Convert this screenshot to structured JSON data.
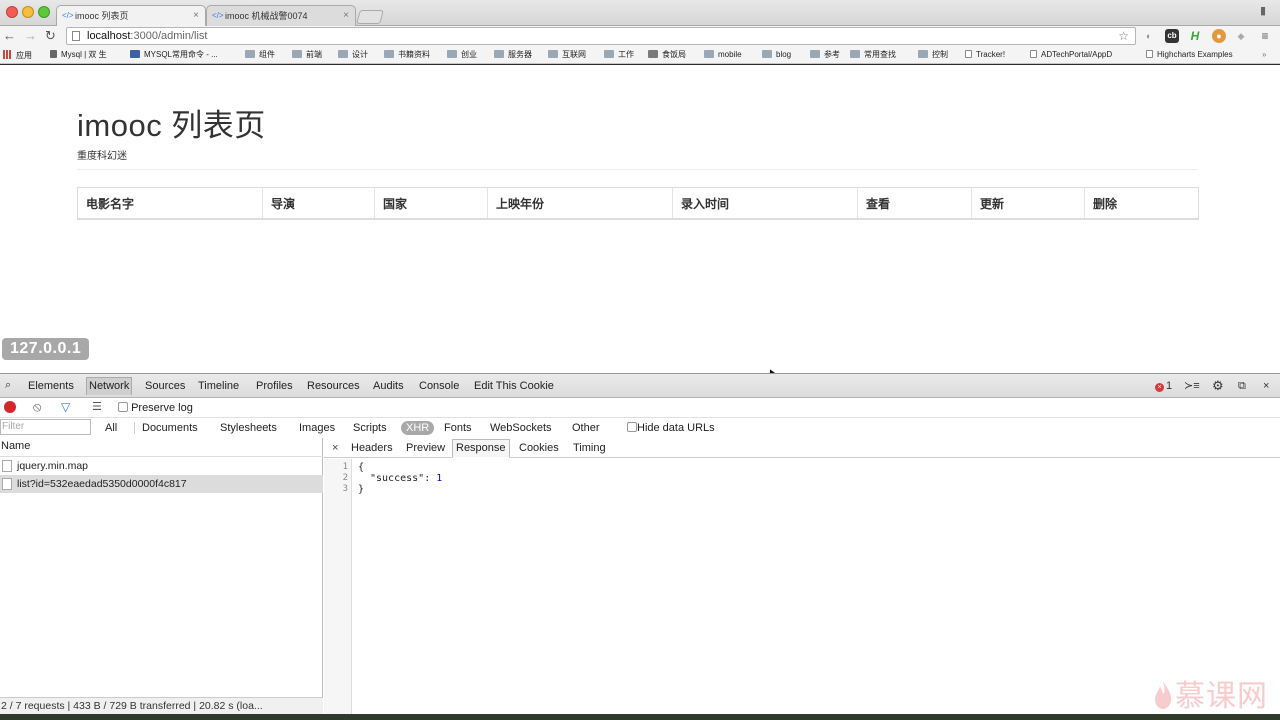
{
  "browser": {
    "tabs": [
      {
        "title": "imooc 列表页",
        "active": true
      },
      {
        "title": "imooc 机械战警0074",
        "active": false
      }
    ],
    "url_host": "localhost",
    "url_path": ":3000/admin/list",
    "bookmarks": [
      "应用",
      "Mysql | 双 生",
      "MYSQL常用命令 - ...",
      "组件",
      "前端",
      "设计",
      "书籍资料",
      "创业",
      "服务器",
      "互联网",
      "工作",
      "食饭局",
      "mobile",
      "blog",
      "参考",
      "常用查找",
      "控制",
      "Tracker!",
      "ADTechPortal/AppD",
      "Highcharts Examples"
    ],
    "extension_labels": [
      "cb",
      "H"
    ]
  },
  "page": {
    "title": "imooc 列表页",
    "subtitle": "重度科幻迷",
    "table_headers": [
      "电影名字",
      "导演",
      "国家",
      "上映年份",
      "录入时间",
      "查看",
      "更新",
      "删除"
    ],
    "host_badge": "127.0.0.1"
  },
  "devtools": {
    "tabs": [
      "Elements",
      "Network",
      "Sources",
      "Timeline",
      "Profiles",
      "Resources",
      "Audits",
      "Console",
      "Edit This Cookie"
    ],
    "selected_tab": "Network",
    "error_count": "1",
    "preserve_log": "Preserve log",
    "filter_placeholder": "Filter",
    "resource_types": [
      "All",
      "Documents",
      "Stylesheets",
      "Images",
      "Scripts",
      "XHR",
      "Fonts",
      "WebSockets",
      "Other"
    ],
    "selected_type": "XHR",
    "hide_data_urls": "Hide data URLs",
    "name_header": "Name",
    "requests": [
      {
        "name": "jquery.min.map",
        "selected": false
      },
      {
        "name": "list?id=532eaedad5350d0000f4c817",
        "selected": true
      }
    ],
    "footer": "2 / 7 requests | 433 B / 729 B transferred | 20.82 s (loa...",
    "detail_tabs": [
      "Headers",
      "Preview",
      "Response",
      "Cookies",
      "Timing"
    ],
    "selected_detail": "Response",
    "response_lines": [
      {
        "num": "1",
        "text": "{"
      },
      {
        "num": "2",
        "key": "\"success\"",
        "value": "1"
      },
      {
        "num": "3",
        "text": "}"
      }
    ]
  },
  "watermark": "慕课网"
}
